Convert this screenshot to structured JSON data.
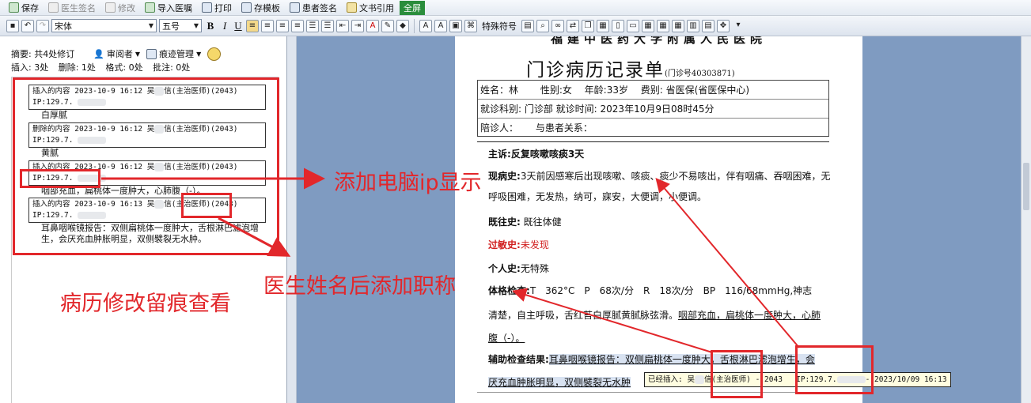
{
  "toolbar1": {
    "save": "保存",
    "doctor_sign": "医生签名",
    "edit": "修改",
    "import_order": "导入医嘱",
    "print": "打印",
    "save_template": "存模板",
    "patient_sign": "患者签名",
    "doc_ref": "文书引用",
    "fullscreen": "全屏"
  },
  "toolbar2": {
    "font": "宋体",
    "size": "五号",
    "bold": "B",
    "italic": "I",
    "underline": "U",
    "special_char": "特殊符号"
  },
  "left_panel": {
    "summary": "摘要: 共4处修订",
    "reviewer": "审阅者",
    "trace_mgmt": "痕迹管理",
    "stats": {
      "insert": "插入: 3处",
      "delete": "删除: 1处",
      "format": "格式: 0处",
      "comment": "批注: 0处"
    },
    "revisions": [
      {
        "line1": "插入的内容 2023-10-9 16:12  吴",
        "line1b": "信(主治医师)(2043)",
        "line2": "IP:129.7.",
        "content": "白厚腻"
      },
      {
        "line1": "删除的内容 2023-10-9 16:12  吴",
        "line1b": "信(主治医师)(2043)",
        "line2": "IP:129.7.",
        "content": "黄腻"
      },
      {
        "line1": "插入的内容 2023-10-9 16:12  吴",
        "line1b": "信(主治医师)(2043)",
        "line2": "IP:129.7.",
        "content": "咽部充血，扁桃体一度肿大，心肺腹（-）。"
      },
      {
        "line1": "插入的内容 2023-10-9 16:13  吴",
        "line1b": "信(主治医师)(2043)",
        "line2": "IP:129.7.",
        "content": "耳鼻咽喉镜报告：双侧扁桃体一度肿大，舌根淋巴滤泡增生，会厌充血肿胀明显，双侧襞裂无水肿。"
      }
    ]
  },
  "document": {
    "hospital": "福建中医药大学附属人民医院",
    "title": "门诊病历记录单",
    "clinic_no": "(门诊号40303871)",
    "row1": "姓名：林　　 性别:女　 年龄:33岁　 费别: 省医保(省医保中心)",
    "row2": "就诊科别: 门诊部 就诊时间: 2023年10月9日08时45分",
    "row3": "陪诊人：　　 与患者关系：",
    "chief_label": "主诉:",
    "chief": "反复咳嗽咳痰3天",
    "present_label": "现病史:",
    "present": "3天前因感寒后出现咳嗽、咳痰、痰少不易咳出，伴有咽痛、吞咽困难，无呼吸困难，无发热，纳可，寐安，大便调，小便调。",
    "past_label": "既往史:",
    "past": "既往体健",
    "allergy_label": "过敏史:",
    "allergy": "未发现",
    "personal_label": "个人史:",
    "personal": "无特殊",
    "exam_label": "体格检查:",
    "exam1": "T　362°C　P　68次/分　R　18次/分　BP　116/68mmHg,神志",
    "exam2a": "清楚，自主呼吸，舌红苔白厚腻黄腻脉弦滑。",
    "exam2b": "咽部充血，扁桃体一度肿大，心肺",
    "exam3": "腹（-）。",
    "aux_label": "辅助检查结果:",
    "aux1": "耳鼻咽喉镜报告：双侧扁桃体一度肿大，舌根淋巴滤泡增生，会",
    "aux2": "厌充血肿胀明显，双侧襞裂无水肿"
  },
  "tooltip": {
    "a": "已经插入: 吴",
    "b": "信(主治医师) - 2043",
    "c": "IP:129.7.",
    "d": "- 2023/10/09 16:13"
  },
  "annotations": {
    "ip": "添加电脑ip显示",
    "title": "医生姓名后添加职称",
    "trace": "病历修改留痕查看"
  },
  "colors": {
    "annotation": "#e2272b",
    "workspace": "#7f9bc1",
    "fullscreen_bg": "#2a8d3c"
  }
}
